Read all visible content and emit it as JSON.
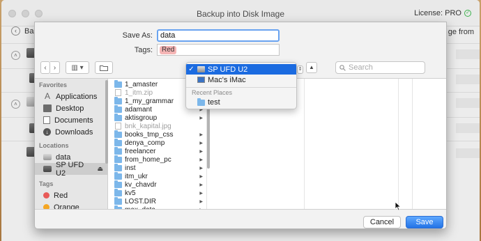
{
  "app": {
    "title": "Backup into Disk Image",
    "license": "License: PRO",
    "back_label": "Bac",
    "right_truncated": "ge from"
  },
  "sheet": {
    "save_as_label": "Save As:",
    "save_as_value": "data",
    "tags_label": "Tags:",
    "tag_value": "Red",
    "search_placeholder": "Search"
  },
  "sidebar": {
    "favorites_header": "Favorites",
    "favorites": [
      {
        "label": "Applications",
        "icon": "applications-icon"
      },
      {
        "label": "Desktop",
        "icon": "desktop-icon"
      },
      {
        "label": "Documents",
        "icon": "documents-icon"
      },
      {
        "label": "Downloads",
        "icon": "downloads-icon"
      }
    ],
    "locations_header": "Locations",
    "locations": [
      {
        "label": "data",
        "icon": "drive-icon"
      },
      {
        "label": "SP UFD U2",
        "icon": "drive-icon",
        "selected": true,
        "eject": "⏏"
      }
    ],
    "tags_header": "Tags",
    "tags": [
      {
        "label": "Red",
        "color": "#e85a58"
      },
      {
        "label": "Orange",
        "color": "#f5a623"
      }
    ]
  },
  "files": [
    {
      "name": "1_amaster",
      "type": "folder",
      "dim": false,
      "arrow": true
    },
    {
      "name": "1_itm.zip",
      "type": "file",
      "dim": true,
      "arrow": false
    },
    {
      "name": "1_my_grammar",
      "type": "folder",
      "dim": false,
      "arrow": true
    },
    {
      "name": "adamant",
      "type": "folder",
      "dim": false,
      "arrow": true
    },
    {
      "name": "aktisgroup",
      "type": "folder",
      "dim": false,
      "arrow": true
    },
    {
      "name": "bnk_kapital.jpg",
      "type": "file",
      "dim": true,
      "arrow": false
    },
    {
      "name": "books_tmp_css",
      "type": "folder",
      "dim": false,
      "arrow": true
    },
    {
      "name": "denya_comp",
      "type": "folder",
      "dim": false,
      "arrow": true
    },
    {
      "name": "freelancer",
      "type": "folder",
      "dim": false,
      "arrow": true
    },
    {
      "name": "from_home_pc",
      "type": "folder",
      "dim": false,
      "arrow": true
    },
    {
      "name": "inst",
      "type": "folder",
      "dim": false,
      "arrow": true
    },
    {
      "name": "itm_ukr",
      "type": "folder",
      "dim": false,
      "arrow": true
    },
    {
      "name": "kv_chavdr",
      "type": "folder",
      "dim": false,
      "arrow": true
    },
    {
      "name": "kv5",
      "type": "folder",
      "dim": false,
      "arrow": true
    },
    {
      "name": "LOST.DIR",
      "type": "folder",
      "dim": false,
      "arrow": true
    },
    {
      "name": "max_data",
      "type": "folder",
      "dim": false,
      "arrow": true
    }
  ],
  "dropdown": {
    "items": [
      {
        "label": "SP UFD U2",
        "checked": true,
        "icon": "drive-icon"
      },
      {
        "label": "Mac's iMac",
        "checked": false,
        "icon": "imac-icon"
      }
    ],
    "recent_header": "Recent Places",
    "recent": [
      {
        "label": "test",
        "icon": "folder-icon"
      }
    ]
  },
  "buttons": {
    "cancel": "Cancel",
    "save": "Save"
  },
  "colors": {
    "accent": "#2373e6",
    "folder": "#7cb7ea",
    "tag_red": "#f5b5b5"
  }
}
